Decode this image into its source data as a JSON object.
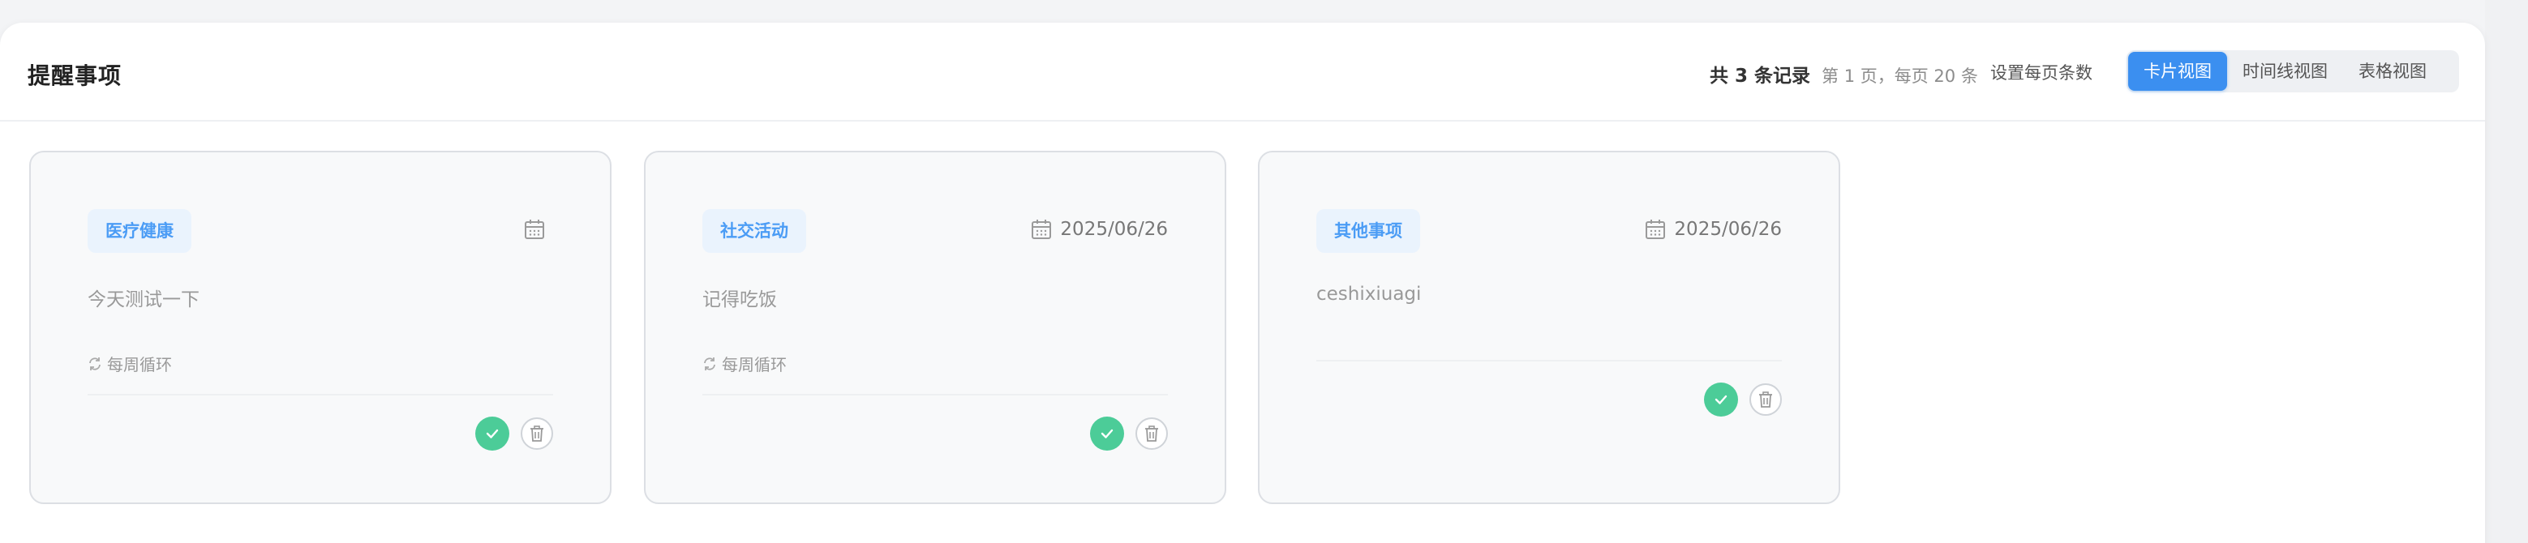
{
  "header": {
    "title": "提醒事项",
    "stats_total": "共 3 条记录",
    "stats_page": "第 1 页，每页 20 条",
    "set_page_size": "设置每页条数",
    "views": [
      {
        "label": "卡片视图",
        "active": true
      },
      {
        "label": "时间线视图",
        "active": false
      },
      {
        "label": "表格视图",
        "active": false
      }
    ]
  },
  "cards": [
    {
      "tag": "医疗健康",
      "date": "",
      "content": "今天测试一下",
      "repeat": "每周循环"
    },
    {
      "tag": "社交活动",
      "date": "2025/06/26",
      "content": "记得吃饭",
      "repeat": "每周循环"
    },
    {
      "tag": "其他事项",
      "date": "2025/06/26",
      "content": "ceshixiuagi",
      "repeat": ""
    }
  ],
  "colors": {
    "accent": "#3b8ff0",
    "tag_text": "#4b9cf5",
    "tag_bg": "#eaf3fd",
    "done": "#4ccc98"
  },
  "icons": [
    "calendar-icon",
    "repeat-icon",
    "check-icon",
    "trash-icon"
  ]
}
